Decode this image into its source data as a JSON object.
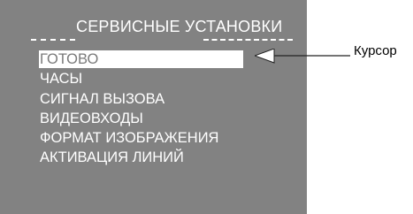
{
  "menu": {
    "title": "СЕРВИСНЫЕ УСТАНОВКИ",
    "items": [
      {
        "label": "ГОТОВО",
        "selected": true
      },
      {
        "label": "ЧАСЫ",
        "selected": false
      },
      {
        "label": "СИГНАЛ ВЫЗОВА",
        "selected": false
      },
      {
        "label": "ВИДЕОВХОДЫ",
        "selected": false
      },
      {
        "label": "ФОРМАТ ИЗОБРАЖЕНИЯ",
        "selected": false
      },
      {
        "label": "АКТИВАЦИЯ ЛИНИЙ",
        "selected": false
      }
    ]
  },
  "annotation": {
    "label": "Курсор",
    "icon": "arrow-left-icon"
  },
  "colors": {
    "panel_background": "#828282",
    "menu_text": "#ffffff",
    "selected_background": "#ffffff",
    "selected_text": "#7a7a7a",
    "annotation_text": "#000000"
  }
}
